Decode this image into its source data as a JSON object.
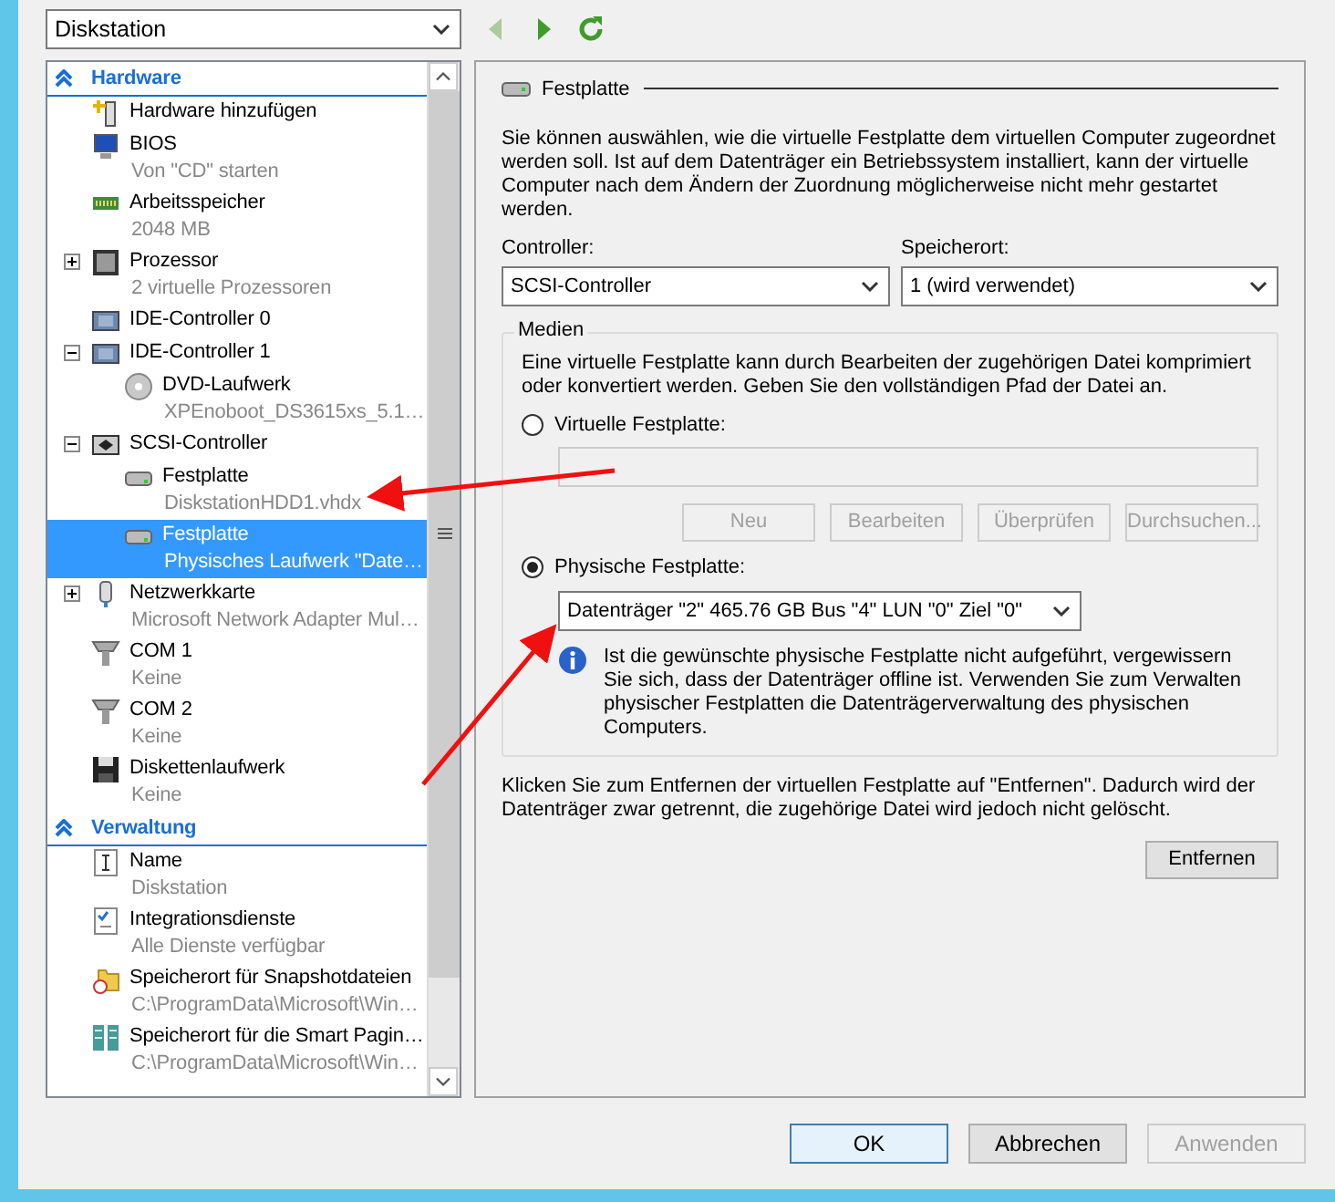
{
  "vm_select": {
    "value": "Diskstation"
  },
  "nav": [
    {
      "kind": "back",
      "disabled": true
    },
    {
      "kind": "forward",
      "disabled": false
    },
    {
      "kind": "refresh",
      "disabled": false
    }
  ],
  "tree": {
    "sections": [
      {
        "title": "Hardware",
        "expanded": true,
        "items": [
          {
            "kind": "add",
            "label": "Hardware hinzufügen",
            "selected": false
          },
          {
            "kind": "bios",
            "label": "BIOS",
            "detail": "Von \"CD\" starten",
            "selected": false
          },
          {
            "kind": "memory",
            "label": "Arbeitsspeicher",
            "detail": "2048 MB",
            "selected": false
          },
          {
            "kind": "cpu",
            "label": "Prozessor",
            "detail": "2 virtuelle Prozessoren",
            "expanded": false,
            "selected": false
          },
          {
            "kind": "controller",
            "label": "IDE-Controller 0",
            "selected": false
          },
          {
            "kind": "controller",
            "label": "IDE-Controller 1",
            "expanded": true,
            "selected": false,
            "children": [
              {
                "kind": "dvd",
                "label": "DVD-Laufwerk",
                "detail": "XPEnoboot_DS3615xs_5.1…",
                "selected": false
              }
            ]
          },
          {
            "kind": "scsi",
            "label": "SCSI-Controller",
            "expanded": true,
            "selected": false,
            "children": [
              {
                "kind": "disk",
                "label": "Festplatte",
                "detail": "DiskstationHDD1.vhdx",
                "selected": false
              },
              {
                "kind": "disk",
                "label": "Festplatte",
                "detail": "Physisches Laufwerk \"Date…",
                "selected": true
              }
            ]
          },
          {
            "kind": "network",
            "label": "Netzwerkkarte",
            "detail": "Microsoft Network Adapter Mul…",
            "expanded": false,
            "selected": false
          },
          {
            "kind": "com",
            "label": "COM 1",
            "detail": "Keine",
            "selected": false
          },
          {
            "kind": "com",
            "label": "COM 2",
            "detail": "Keine",
            "selected": false
          },
          {
            "kind": "floppy",
            "label": "Diskettenlaufwerk",
            "detail": "Keine",
            "selected": false
          }
        ]
      },
      {
        "title": "Verwaltung",
        "expanded": true,
        "items": [
          {
            "kind": "name",
            "label": "Name",
            "detail": "Diskstation",
            "selected": false
          },
          {
            "kind": "services",
            "label": "Integrationsdienste",
            "detail": "Alle Dienste verfügbar",
            "selected": false
          },
          {
            "kind": "folder",
            "label": "Speicherort für Snapshotdateien",
            "detail": "C:\\ProgramData\\Microsoft\\Win…",
            "selected": false
          },
          {
            "kind": "paging",
            "label": "Speicherort für die Smart Pagin…",
            "detail": "C:\\ProgramData\\Microsoft\\Win…",
            "selected": false
          }
        ]
      }
    ]
  },
  "panel": {
    "title": "Festplatte",
    "intro": "Sie können auswählen, wie die virtuelle Festplatte dem virtuellen Computer zugeordnet werden soll. Ist auf dem Datenträger ein Betriebssystem installiert, kann der virtuelle Computer nach dem Ändern der Zuordnung möglicherweise nicht mehr gestartet werden.",
    "controller": {
      "label": "Controller:",
      "value": "SCSI-Controller"
    },
    "location": {
      "label": "Speicherort:",
      "value": "1 (wird verwendet)"
    },
    "media": {
      "title": "Medien",
      "text": "Eine virtuelle Festplatte kann durch Bearbeiten der zugehörigen Datei komprimiert oder konvertiert werden. Geben Sie den vollständigen Pfad der Datei an.",
      "virtual": {
        "label": "Virtuelle Festplatte:",
        "selected": false,
        "disabled": true,
        "buttons": [
          {
            "label": "Neu",
            "disabled": true
          },
          {
            "label": "Bearbeiten",
            "disabled": true
          },
          {
            "label": "Überprüfen",
            "disabled": true
          },
          {
            "label": "Durchsuchen...",
            "disabled": true
          }
        ]
      },
      "physical": {
        "label": "Physische Festplatte:",
        "selected": true,
        "value": "Datenträger \"2\" 465.76 GB Bus \"4\" LUN \"0\" Ziel \"0\""
      },
      "info": "Ist die gewünschte physische Festplatte nicht aufgeführt, vergewissern Sie sich, dass der Datenträger offline ist. Verwenden Sie zum Verwalten physischer Festplatten die Datenträgerverwaltung des physischen Computers."
    },
    "remove_text": "Klicken Sie zum Entfernen der virtuellen Festplatte auf \"Entfernen\". Dadurch wird der Datenträger zwar getrennt, die zugehörige Datei wird jedoch nicht gelöscht.",
    "remove_button": {
      "label": "Entfernen",
      "disabled": false
    }
  },
  "footer": [
    {
      "label": "OK",
      "default": true,
      "disabled": false
    },
    {
      "label": "Abbrechen",
      "default": false,
      "disabled": false
    },
    {
      "label": "Anwenden",
      "default": false,
      "disabled": true
    }
  ]
}
